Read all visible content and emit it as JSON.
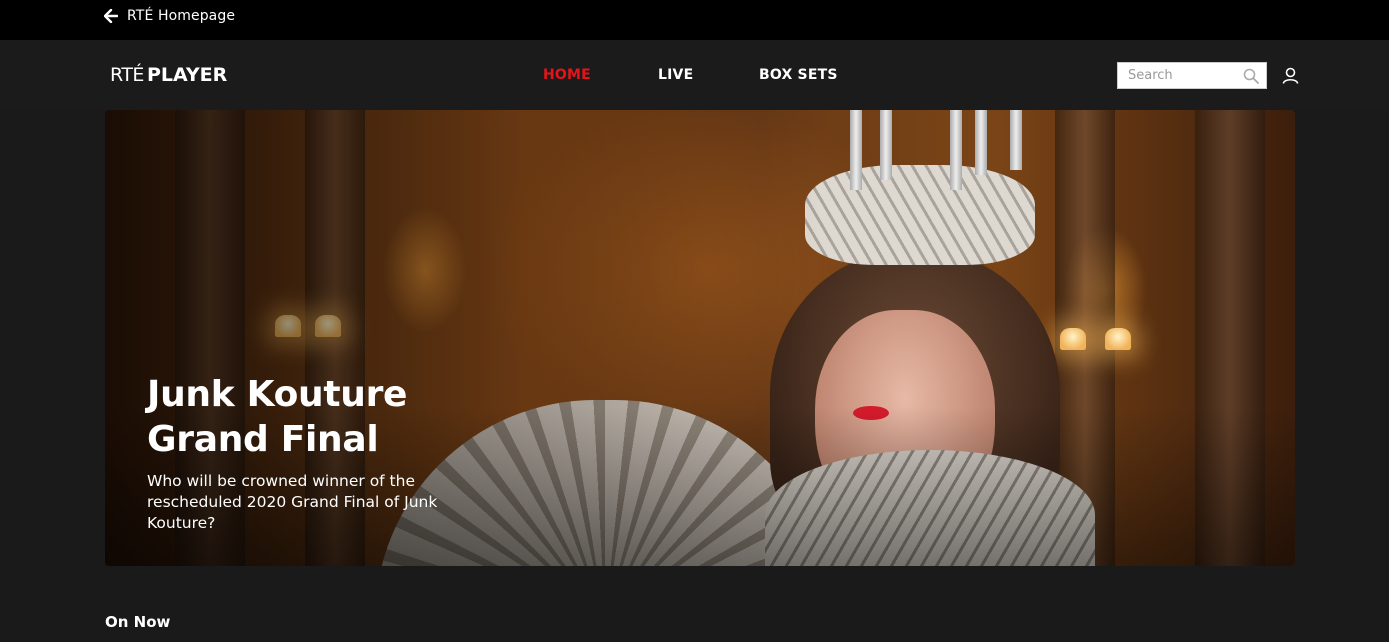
{
  "topbar": {
    "back_label": "RTÉ Homepage",
    "back_icon": "arrow-left-icon"
  },
  "header": {
    "logo_rte": "RTÉ",
    "logo_player": "PLAYER",
    "tabs": [
      {
        "label": "HOME",
        "active": true
      },
      {
        "label": "LIVE",
        "active": false
      },
      {
        "label": "BOX SETS",
        "active": false
      }
    ],
    "search": {
      "placeholder": "Search",
      "value": "",
      "icon": "search-icon"
    },
    "account_icon": "user-icon",
    "accent_color": "#e5141b"
  },
  "hero": {
    "title": "Junk Kouture Grand Final",
    "description": "Who will be crowned winner of the rescheduled 2020 Grand Final of Junk Kouture?"
  },
  "sections": [
    {
      "title": "On Now"
    }
  ],
  "colors": {
    "background": "#1a1a1a",
    "topbar": "#000000",
    "accent": "#e5141b"
  }
}
